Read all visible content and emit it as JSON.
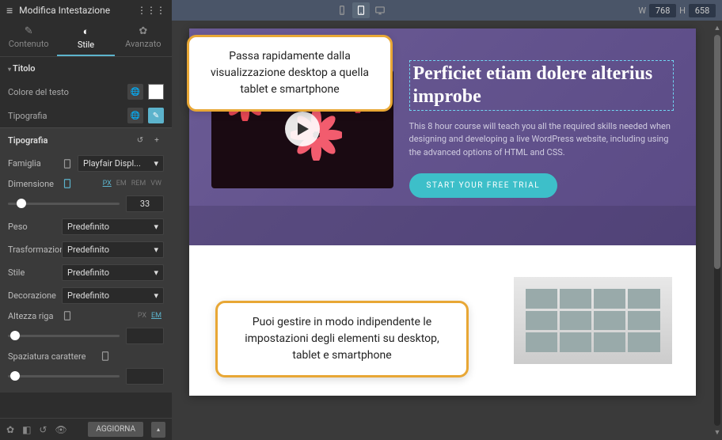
{
  "header": {
    "title": "Modifica Intestazione",
    "dims": {
      "w_label": "W",
      "w": "768",
      "h_label": "H",
      "h": "658"
    }
  },
  "tabs": {
    "content": "Contenuto",
    "style": "Stile",
    "advanced": "Avanzato"
  },
  "section": {
    "title": "Titolo"
  },
  "controls": {
    "text_color": "Colore del testo",
    "typography": "Tipografia",
    "typo_panel": "Tipografia",
    "family": "Famiglia",
    "family_value": "Playfair Displ...",
    "size": "Dimensione",
    "size_value": "33",
    "units": [
      "PX",
      "EM",
      "REM",
      "VW"
    ],
    "weight": "Peso",
    "transform": "Trasformazione",
    "font_style": "Stile",
    "decoration": "Decorazione",
    "default_value": "Predefinito",
    "line_height": "Altezza riga",
    "line_units": [
      "PX",
      "EM"
    ],
    "letter_spacing": "Spaziatura carattere"
  },
  "footer": {
    "update": "AGGIORNA"
  },
  "preview": {
    "hero_title": "Perficiet etiam dolere alterius improbe",
    "hero_desc": "This 8 hour course will teach you all the required skills needed when designing and developing a live WordPress website, including using the advanced options of HTML and CSS.",
    "cta": "START YOUR FREE TRIAL"
  },
  "callouts": {
    "c1": "Passa rapidamente dalla visualizzazione desktop a quella tablet e smartphone",
    "c2": "Puoi gestire in modo indipendente le impostazioni degli elementi su desktop, tablet e smartphone"
  }
}
